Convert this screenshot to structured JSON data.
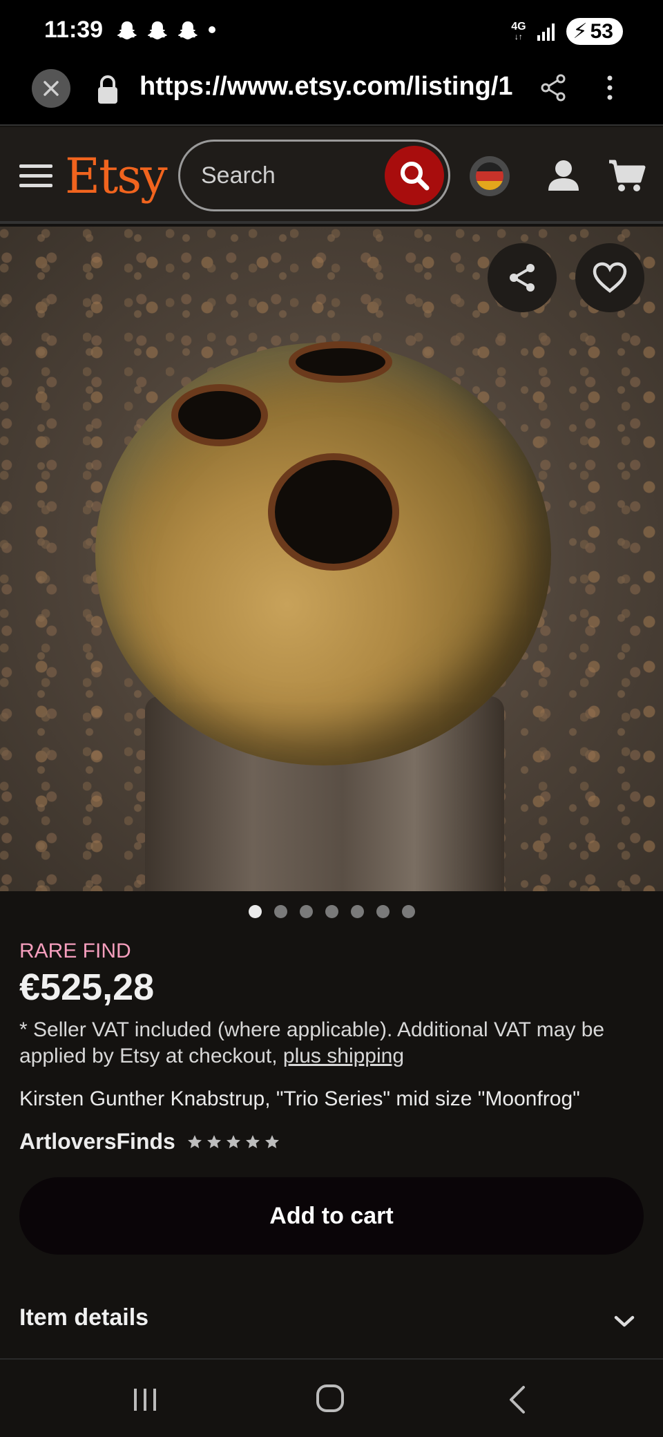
{
  "status_bar": {
    "time": "11:39",
    "network": "4G",
    "battery": "53"
  },
  "browser": {
    "url": "https://www.etsy.com/listing/1"
  },
  "header": {
    "logo": "Etsy",
    "search_placeholder": "Search"
  },
  "gallery": {
    "total_images": 7,
    "active_index": 0
  },
  "listing": {
    "badge": "RARE FIND",
    "price": "€525,28",
    "vat_text": "* Seller VAT included (where applicable). Additional VAT may be applied by Etsy at checkout, ",
    "shipping_link": "plus shipping",
    "title": "Kirsten Gunther Knabstrup, \"Trio Series\" mid size \"Moonfrog\"",
    "shop_name": "ArtloversFinds",
    "rating_stars": 5
  },
  "actions": {
    "add_to_cart": "Add to cart"
  },
  "sections": {
    "item_details": "Item details"
  },
  "colors": {
    "accent_orange": "#f1641e",
    "search_button": "#a80d0d",
    "rare_pink": "#f59ebd"
  }
}
